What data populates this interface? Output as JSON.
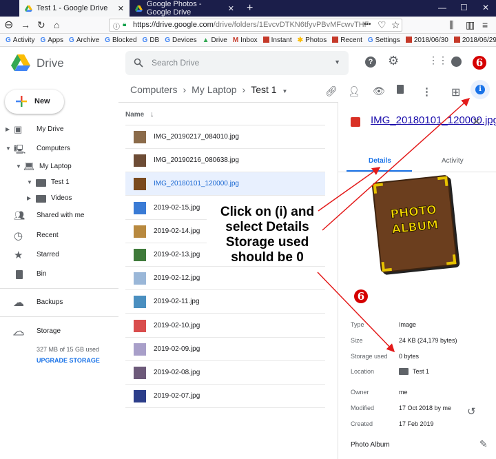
{
  "browser": {
    "tabs": [
      {
        "title": "Test 1 - Google Drive",
        "active": true
      },
      {
        "title": "Google Photos - Google Drive",
        "active": false
      }
    ],
    "new_tab": "+",
    "url_host": "https://drive.google.com",
    "url_path": "/drive/folders/1EvcvDTKN6tfyvPBvMFcwvTHF",
    "url_more": "•••",
    "bookmarks": [
      "Activity",
      "Apps",
      "Archive",
      "Blocked",
      "DB",
      "Devices",
      "Drive",
      "Inbox",
      "Instant",
      "Photos",
      "Recent",
      "Settings",
      "2018/06/30",
      "2018/06/29"
    ]
  },
  "header": {
    "brand": "Drive",
    "search_placeholder": "Search Drive"
  },
  "sidebar": {
    "new_label": "New",
    "items": [
      {
        "label": "My Drive",
        "icon": "drive-icon"
      },
      {
        "label": "Computers",
        "icon": "computers-icon"
      },
      {
        "label": "My Laptop",
        "icon": "laptop-icon"
      },
      {
        "label": "Test 1",
        "icon": "folder-icon"
      },
      {
        "label": "Videos",
        "icon": "folder-icon"
      },
      {
        "label": "Shared with me",
        "icon": "people-icon"
      },
      {
        "label": "Recent",
        "icon": "clock-icon"
      },
      {
        "label": "Starred",
        "icon": "star-icon"
      },
      {
        "label": "Bin",
        "icon": "trash-icon"
      },
      {
        "label": "Backups",
        "icon": "cloud-icon"
      },
      {
        "label": "Storage",
        "icon": "cloud-outline-icon"
      }
    ],
    "storage_used": "327 MB of 15 GB used",
    "upgrade": "UPGRADE STORAGE"
  },
  "breadcrumb": {
    "items": [
      "Computers",
      "My Laptop",
      "Test 1"
    ],
    "sep": "›"
  },
  "file_list": {
    "name_header": "Name",
    "files": [
      {
        "name": "IMG_20190217_084010.jpg",
        "thumb": "#8b6b4a",
        "selected": false
      },
      {
        "name": "IMG_20190216_080638.jpg",
        "thumb": "#6d4c35",
        "selected": false
      },
      {
        "name": "IMG_20180101_120000.jpg",
        "thumb": "#7a4a1e",
        "selected": true
      },
      {
        "name": "2019-02-15.jpg",
        "thumb": "#3a7bd5",
        "selected": false
      },
      {
        "name": "2019-02-14.jpg",
        "thumb": "#b8893f",
        "selected": false
      },
      {
        "name": "2019-02-13.jpg",
        "thumb": "#3f7a3a",
        "selected": false
      },
      {
        "name": "2019-02-12.jpg",
        "thumb": "#9ab7d8",
        "selected": false
      },
      {
        "name": "2019-02-11.jpg",
        "thumb": "#4a8fc0",
        "selected": false
      },
      {
        "name": "2019-02-10.jpg",
        "thumb": "#d94d4d",
        "selected": false
      },
      {
        "name": "2019-02-09.jpg",
        "thumb": "#a89fc9",
        "selected": false
      },
      {
        "name": "2019-02-08.jpg",
        "thumb": "#6d5a7a",
        "selected": false
      },
      {
        "name": "2019-02-07.jpg",
        "thumb": "#2c3e8a",
        "selected": false
      }
    ]
  },
  "details": {
    "title": "IMG_20180101_120000.jpg",
    "tab_details": "Details",
    "tab_activity": "Activity",
    "preview_text_1": "PHOTO",
    "preview_text_2": "ALBUM",
    "props": [
      {
        "k": "Type",
        "v": "Image"
      },
      {
        "k": "Size",
        "v": "24 KB (24,179 bytes)"
      },
      {
        "k": "Storage used",
        "v": "0 bytes"
      },
      {
        "k": "Location",
        "v": "Test 1"
      },
      {
        "k": "Owner",
        "v": "me"
      },
      {
        "k": "Modified",
        "v": "17 Oct 2018 by me"
      },
      {
        "k": "Created",
        "v": "17 Feb 2019"
      }
    ],
    "description": "Photo Album"
  },
  "annotation": {
    "lines": [
      "Click on (i) and",
      "select Details",
      "Storage used",
      "should be 0"
    ],
    "marker": "6"
  },
  "colors": {
    "accent": "#1a73e8",
    "selected_row": "#e8f0fe",
    "annotation_red": "#d50000"
  }
}
